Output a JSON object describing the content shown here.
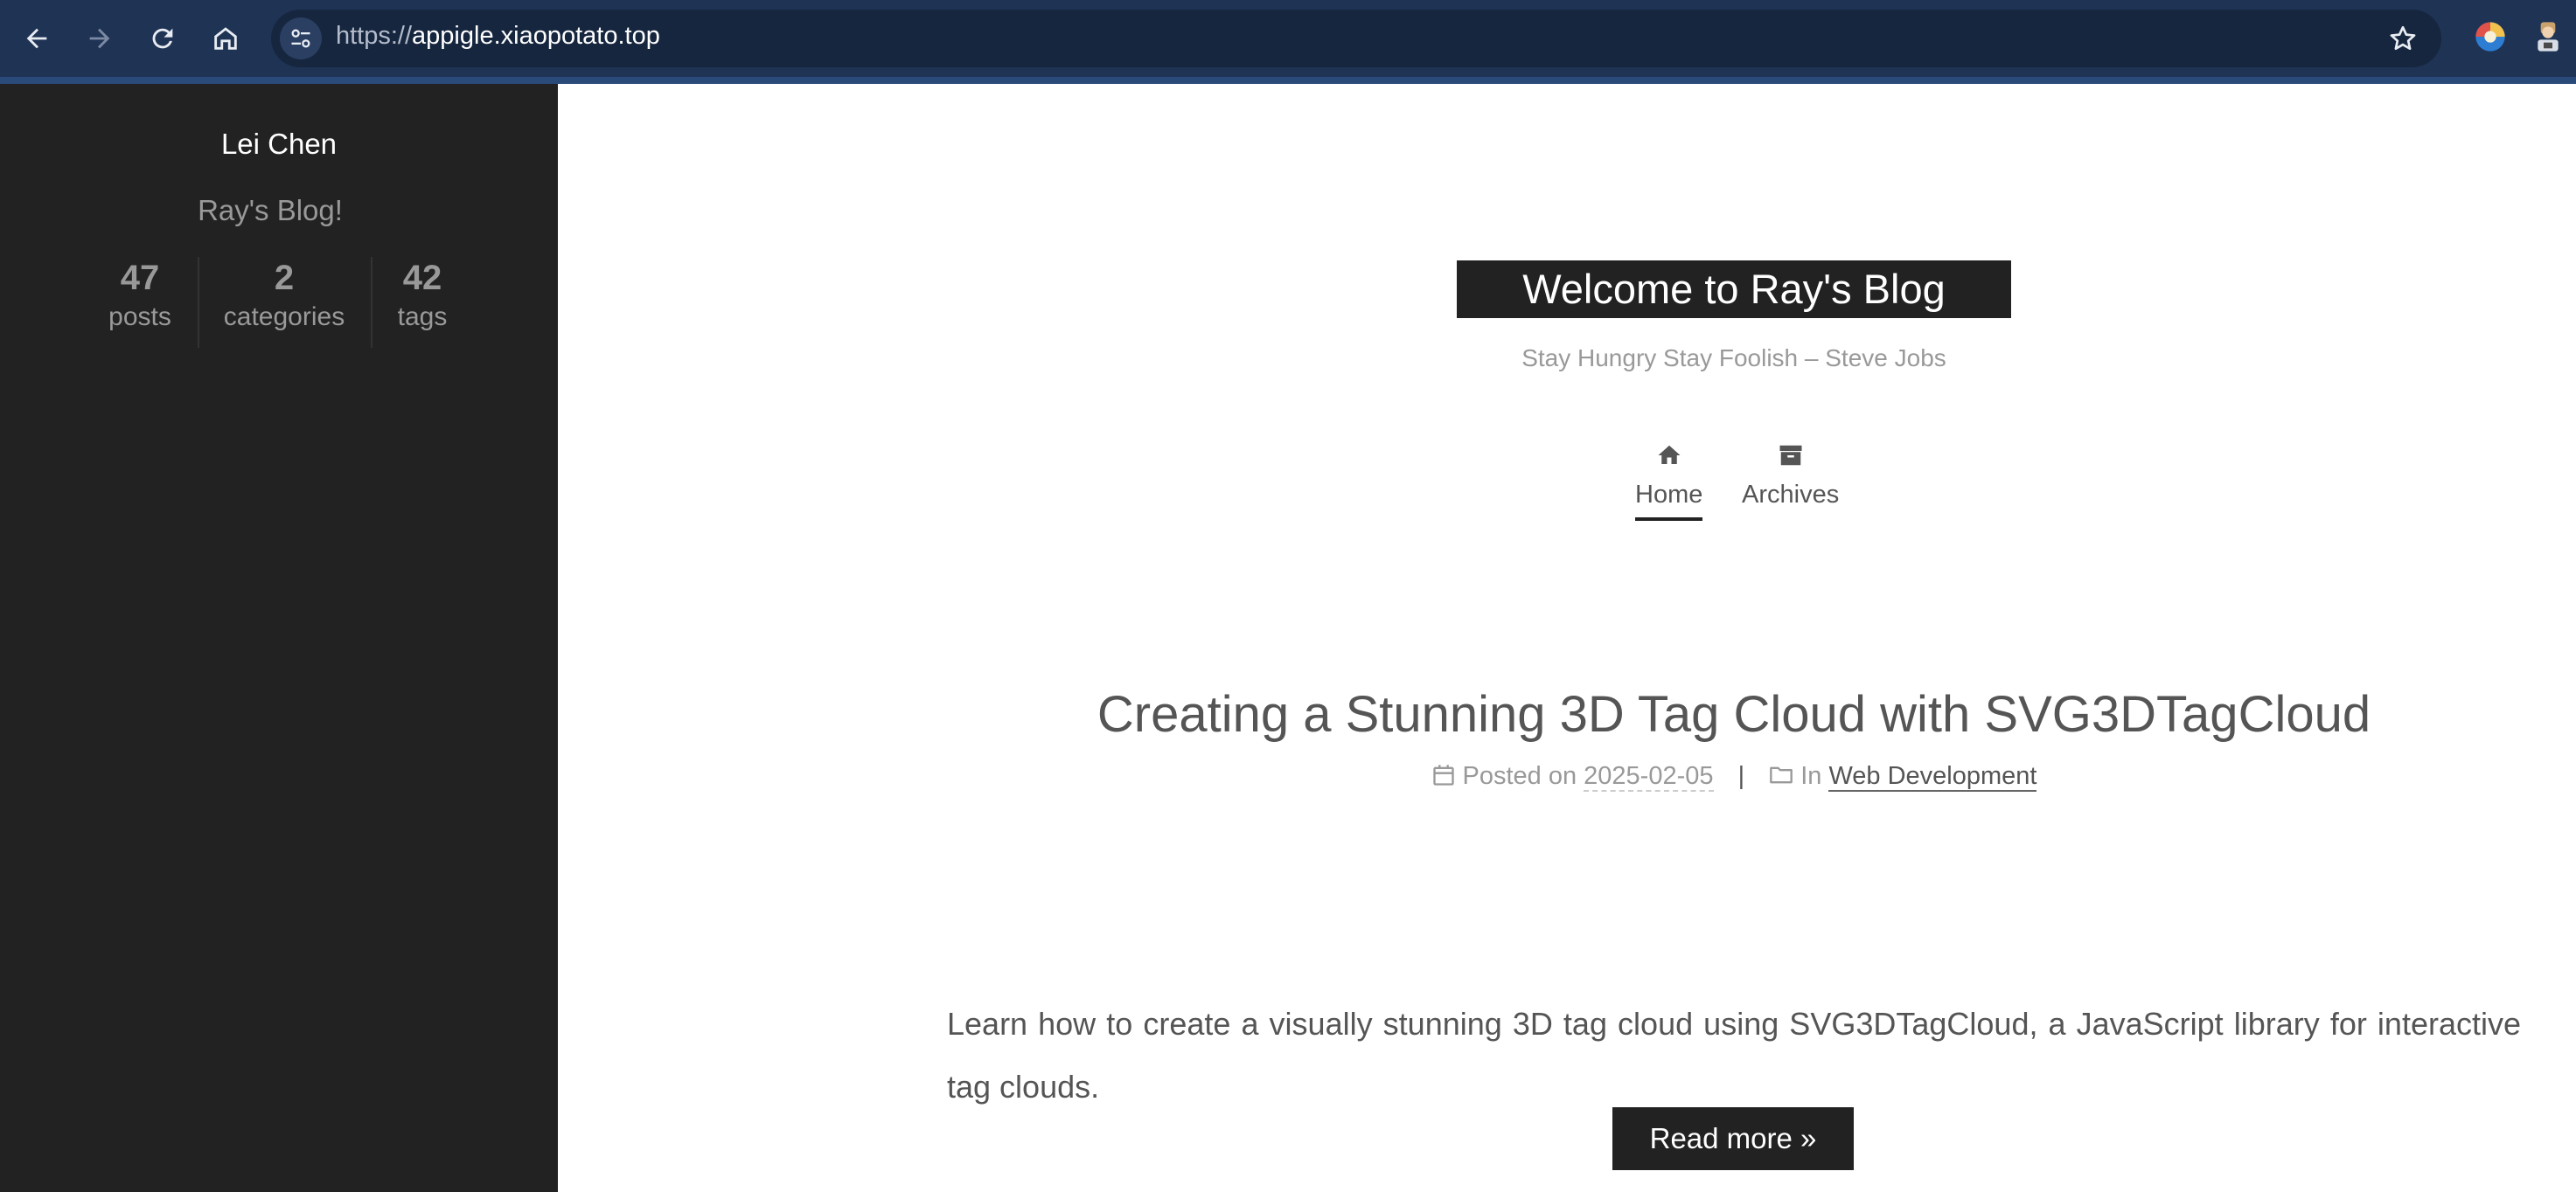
{
  "browser": {
    "url_scheme": "https://",
    "url_host": "appigle.xiaopotato.top"
  },
  "sidebar": {
    "author": "Lei Chen",
    "subtitle": "Ray's Blog!",
    "stats": [
      {
        "num": "47",
        "label": "posts"
      },
      {
        "num": "2",
        "label": "categories"
      },
      {
        "num": "42",
        "label": "tags"
      }
    ]
  },
  "header": {
    "brand": "Welcome to Ray's Blog",
    "tagline": "Stay Hungry Stay Foolish – Steve Jobs",
    "menu": [
      {
        "label": "Home",
        "icon": "home-icon",
        "active": true
      },
      {
        "label": "Archives",
        "icon": "archive-icon",
        "active": false
      }
    ]
  },
  "post": {
    "title": "Creating a Stunning 3D Tag Cloud with SVG3DTagCloud",
    "posted_on_label": "Posted on",
    "date": "2025-02-05",
    "separator": "|",
    "in_label": "In",
    "category": "Web Development",
    "excerpt": "Learn how to create a visually stunning 3D tag cloud using SVG3DTagCloud, a JavaScript library for interactive tag clouds.",
    "read_more": "Read more »"
  },
  "colors": {
    "chrome_bg": "#1f3355",
    "sidebar_bg": "#222222",
    "text_dark": "#555555",
    "text_muted": "#999999"
  }
}
